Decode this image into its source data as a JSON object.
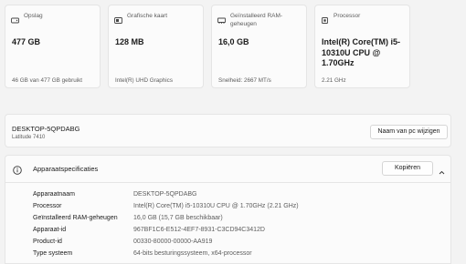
{
  "cards": [
    {
      "label": "Opslag",
      "value": "477 GB",
      "sub": "46 GB van 477 GB gebruikt",
      "icon": "storage-icon"
    },
    {
      "label": "Grafische kaart",
      "value": "128 MB",
      "sub": "Intel(R) UHD Graphics",
      "icon": "graphics-card-icon"
    },
    {
      "label": "Geïnstalleerd RAM-geheugen",
      "value": "16,0 GB",
      "sub": "Snelheid: 2667 MT/s",
      "icon": "ram-icon"
    },
    {
      "label": "Processor",
      "value": "Intel(R) Core(TM) i5-10310U CPU @ 1.70GHz",
      "sub": "2.21 GHz",
      "icon": "processor-icon"
    }
  ],
  "device": {
    "name": "DESKTOP-5QPDABG",
    "model": "Latitude 7410",
    "rename_label": "Naam van pc wijzigen"
  },
  "specs": {
    "title": "Apparaatspecificaties",
    "copy_label": "Kopiëren",
    "rows": [
      {
        "k": "Apparaatnaam",
        "v": "DESKTOP-5QPDABG"
      },
      {
        "k": "Processor",
        "v": "Intel(R) Core(TM) i5-10310U CPU @ 1.70GHz (2.21 GHz)"
      },
      {
        "k": "Geïnstalleerd RAM-geheugen",
        "v": "16,0 GB (15,7 GB beschikbaar)"
      },
      {
        "k": "Apparaat-id",
        "v": "967BF1C6-E512-4EF7-8931-C3CD94C3412D"
      },
      {
        "k": "Product-id",
        "v": "00330-80000-00000-AA919"
      },
      {
        "k": "Type systeem",
        "v": "64-bits besturingssysteem, x64-processor"
      }
    ]
  }
}
